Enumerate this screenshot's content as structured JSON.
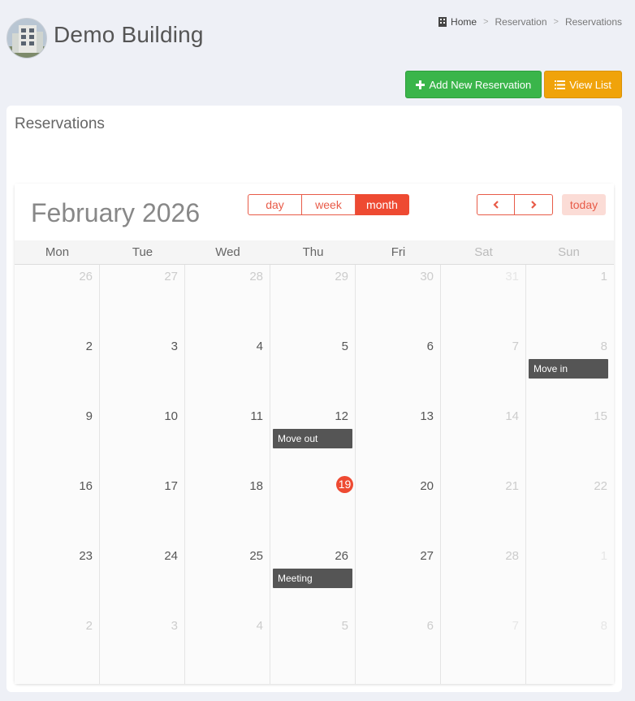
{
  "header": {
    "building_name": "Demo Building",
    "breadcrumb": [
      "Home",
      "Reservation",
      "Reservations"
    ]
  },
  "actions": {
    "add_label": "Add New Reservation",
    "list_label": "View List"
  },
  "panel": {
    "title": "Reservations"
  },
  "calendar": {
    "month_title": "February 2026",
    "views": [
      "day",
      "week",
      "month"
    ],
    "active_view": "month",
    "today_label": "today",
    "weekdays": [
      "Mon",
      "Tue",
      "Wed",
      "Thu",
      "Fri",
      "Sat",
      "Sun"
    ],
    "weeks": [
      [
        {
          "d": "26",
          "o": true
        },
        {
          "d": "27",
          "o": true
        },
        {
          "d": "28",
          "o": true
        },
        {
          "d": "29",
          "o": true
        },
        {
          "d": "30",
          "o": true
        },
        {
          "d": "31",
          "o": true
        },
        {
          "d": "1"
        }
      ],
      [
        {
          "d": "2"
        },
        {
          "d": "3"
        },
        {
          "d": "4"
        },
        {
          "d": "5"
        },
        {
          "d": "6"
        },
        {
          "d": "7"
        },
        {
          "d": "8",
          "event": "Move in"
        }
      ],
      [
        {
          "d": "9"
        },
        {
          "d": "10"
        },
        {
          "d": "11"
        },
        {
          "d": "12",
          "event": "Move out"
        },
        {
          "d": "13"
        },
        {
          "d": "14"
        },
        {
          "d": "15"
        }
      ],
      [
        {
          "d": "16"
        },
        {
          "d": "17"
        },
        {
          "d": "18"
        },
        {
          "d": "19",
          "today": true
        },
        {
          "d": "20"
        },
        {
          "d": "21"
        },
        {
          "d": "22"
        }
      ],
      [
        {
          "d": "23"
        },
        {
          "d": "24"
        },
        {
          "d": "25"
        },
        {
          "d": "26",
          "event": "Meeting"
        },
        {
          "d": "27"
        },
        {
          "d": "28"
        },
        {
          "d": "1",
          "o": true
        }
      ],
      [
        {
          "d": "2",
          "o": true
        },
        {
          "d": "3",
          "o": true
        },
        {
          "d": "4",
          "o": true
        },
        {
          "d": "5",
          "o": true
        },
        {
          "d": "6",
          "o": true
        },
        {
          "d": "7",
          "o": true
        },
        {
          "d": "8",
          "o": true
        }
      ]
    ]
  },
  "colors": {
    "accent": "#ee4a32",
    "green": "#3ab54a",
    "orange": "#f0a30a",
    "event": "#555555"
  },
  "icons": {
    "logo": "building-photo",
    "home": "building-icon",
    "add": "plus-icon",
    "list": "list-icon",
    "prev": "chevron-left-icon",
    "next": "chevron-right-icon"
  }
}
